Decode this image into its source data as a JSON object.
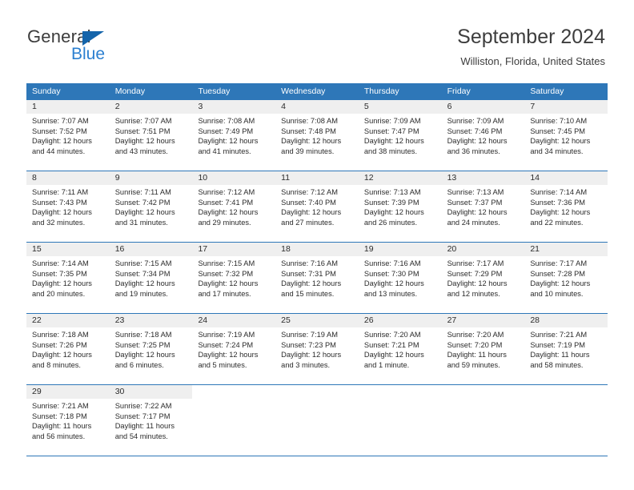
{
  "logo": {
    "word1": "General",
    "word2": "Blue",
    "accent_color": "#1464aa",
    "blue_text_color": "#2b7fd0"
  },
  "header": {
    "title": "September 2024",
    "subtitle": "Williston, Florida, United States"
  },
  "theme": {
    "header_blue": "#2e77b8",
    "date_band_gray": "#efefef",
    "text": "#2b2b2b"
  },
  "calendar": {
    "weekday_headers": [
      "Sunday",
      "Monday",
      "Tuesday",
      "Wednesday",
      "Thursday",
      "Friday",
      "Saturday"
    ],
    "weeks": [
      [
        {
          "date": "1",
          "sunrise": "Sunrise: 7:07 AM",
          "sunset": "Sunset: 7:52 PM",
          "daylight1": "Daylight: 12 hours",
          "daylight2": "and 44 minutes."
        },
        {
          "date": "2",
          "sunrise": "Sunrise: 7:07 AM",
          "sunset": "Sunset: 7:51 PM",
          "daylight1": "Daylight: 12 hours",
          "daylight2": "and 43 minutes."
        },
        {
          "date": "3",
          "sunrise": "Sunrise: 7:08 AM",
          "sunset": "Sunset: 7:49 PM",
          "daylight1": "Daylight: 12 hours",
          "daylight2": "and 41 minutes."
        },
        {
          "date": "4",
          "sunrise": "Sunrise: 7:08 AM",
          "sunset": "Sunset: 7:48 PM",
          "daylight1": "Daylight: 12 hours",
          "daylight2": "and 39 minutes."
        },
        {
          "date": "5",
          "sunrise": "Sunrise: 7:09 AM",
          "sunset": "Sunset: 7:47 PM",
          "daylight1": "Daylight: 12 hours",
          "daylight2": "and 38 minutes."
        },
        {
          "date": "6",
          "sunrise": "Sunrise: 7:09 AM",
          "sunset": "Sunset: 7:46 PM",
          "daylight1": "Daylight: 12 hours",
          "daylight2": "and 36 minutes."
        },
        {
          "date": "7",
          "sunrise": "Sunrise: 7:10 AM",
          "sunset": "Sunset: 7:45 PM",
          "daylight1": "Daylight: 12 hours",
          "daylight2": "and 34 minutes."
        }
      ],
      [
        {
          "date": "8",
          "sunrise": "Sunrise: 7:11 AM",
          "sunset": "Sunset: 7:43 PM",
          "daylight1": "Daylight: 12 hours",
          "daylight2": "and 32 minutes."
        },
        {
          "date": "9",
          "sunrise": "Sunrise: 7:11 AM",
          "sunset": "Sunset: 7:42 PM",
          "daylight1": "Daylight: 12 hours",
          "daylight2": "and 31 minutes."
        },
        {
          "date": "10",
          "sunrise": "Sunrise: 7:12 AM",
          "sunset": "Sunset: 7:41 PM",
          "daylight1": "Daylight: 12 hours",
          "daylight2": "and 29 minutes."
        },
        {
          "date": "11",
          "sunrise": "Sunrise: 7:12 AM",
          "sunset": "Sunset: 7:40 PM",
          "daylight1": "Daylight: 12 hours",
          "daylight2": "and 27 minutes."
        },
        {
          "date": "12",
          "sunrise": "Sunrise: 7:13 AM",
          "sunset": "Sunset: 7:39 PM",
          "daylight1": "Daylight: 12 hours",
          "daylight2": "and 26 minutes."
        },
        {
          "date": "13",
          "sunrise": "Sunrise: 7:13 AM",
          "sunset": "Sunset: 7:37 PM",
          "daylight1": "Daylight: 12 hours",
          "daylight2": "and 24 minutes."
        },
        {
          "date": "14",
          "sunrise": "Sunrise: 7:14 AM",
          "sunset": "Sunset: 7:36 PM",
          "daylight1": "Daylight: 12 hours",
          "daylight2": "and 22 minutes."
        }
      ],
      [
        {
          "date": "15",
          "sunrise": "Sunrise: 7:14 AM",
          "sunset": "Sunset: 7:35 PM",
          "daylight1": "Daylight: 12 hours",
          "daylight2": "and 20 minutes."
        },
        {
          "date": "16",
          "sunrise": "Sunrise: 7:15 AM",
          "sunset": "Sunset: 7:34 PM",
          "daylight1": "Daylight: 12 hours",
          "daylight2": "and 19 minutes."
        },
        {
          "date": "17",
          "sunrise": "Sunrise: 7:15 AM",
          "sunset": "Sunset: 7:32 PM",
          "daylight1": "Daylight: 12 hours",
          "daylight2": "and 17 minutes."
        },
        {
          "date": "18",
          "sunrise": "Sunrise: 7:16 AM",
          "sunset": "Sunset: 7:31 PM",
          "daylight1": "Daylight: 12 hours",
          "daylight2": "and 15 minutes."
        },
        {
          "date": "19",
          "sunrise": "Sunrise: 7:16 AM",
          "sunset": "Sunset: 7:30 PM",
          "daylight1": "Daylight: 12 hours",
          "daylight2": "and 13 minutes."
        },
        {
          "date": "20",
          "sunrise": "Sunrise: 7:17 AM",
          "sunset": "Sunset: 7:29 PM",
          "daylight1": "Daylight: 12 hours",
          "daylight2": "and 12 minutes."
        },
        {
          "date": "21",
          "sunrise": "Sunrise: 7:17 AM",
          "sunset": "Sunset: 7:28 PM",
          "daylight1": "Daylight: 12 hours",
          "daylight2": "and 10 minutes."
        }
      ],
      [
        {
          "date": "22",
          "sunrise": "Sunrise: 7:18 AM",
          "sunset": "Sunset: 7:26 PM",
          "daylight1": "Daylight: 12 hours",
          "daylight2": "and 8 minutes."
        },
        {
          "date": "23",
          "sunrise": "Sunrise: 7:18 AM",
          "sunset": "Sunset: 7:25 PM",
          "daylight1": "Daylight: 12 hours",
          "daylight2": "and 6 minutes."
        },
        {
          "date": "24",
          "sunrise": "Sunrise: 7:19 AM",
          "sunset": "Sunset: 7:24 PM",
          "daylight1": "Daylight: 12 hours",
          "daylight2": "and 5 minutes."
        },
        {
          "date": "25",
          "sunrise": "Sunrise: 7:19 AM",
          "sunset": "Sunset: 7:23 PM",
          "daylight1": "Daylight: 12 hours",
          "daylight2": "and 3 minutes."
        },
        {
          "date": "26",
          "sunrise": "Sunrise: 7:20 AM",
          "sunset": "Sunset: 7:21 PM",
          "daylight1": "Daylight: 12 hours",
          "daylight2": "and 1 minute."
        },
        {
          "date": "27",
          "sunrise": "Sunrise: 7:20 AM",
          "sunset": "Sunset: 7:20 PM",
          "daylight1": "Daylight: 11 hours",
          "daylight2": "and 59 minutes."
        },
        {
          "date": "28",
          "sunrise": "Sunrise: 7:21 AM",
          "sunset": "Sunset: 7:19 PM",
          "daylight1": "Daylight: 11 hours",
          "daylight2": "and 58 minutes."
        }
      ],
      [
        {
          "date": "29",
          "sunrise": "Sunrise: 7:21 AM",
          "sunset": "Sunset: 7:18 PM",
          "daylight1": "Daylight: 11 hours",
          "daylight2": "and 56 minutes."
        },
        {
          "date": "30",
          "sunrise": "Sunrise: 7:22 AM",
          "sunset": "Sunset: 7:17 PM",
          "daylight1": "Daylight: 11 hours",
          "daylight2": "and 54 minutes."
        },
        {
          "date": "",
          "sunrise": "",
          "sunset": "",
          "daylight1": "",
          "daylight2": ""
        },
        {
          "date": "",
          "sunrise": "",
          "sunset": "",
          "daylight1": "",
          "daylight2": ""
        },
        {
          "date": "",
          "sunrise": "",
          "sunset": "",
          "daylight1": "",
          "daylight2": ""
        },
        {
          "date": "",
          "sunrise": "",
          "sunset": "",
          "daylight1": "",
          "daylight2": ""
        },
        {
          "date": "",
          "sunrise": "",
          "sunset": "",
          "daylight1": "",
          "daylight2": ""
        }
      ]
    ]
  }
}
